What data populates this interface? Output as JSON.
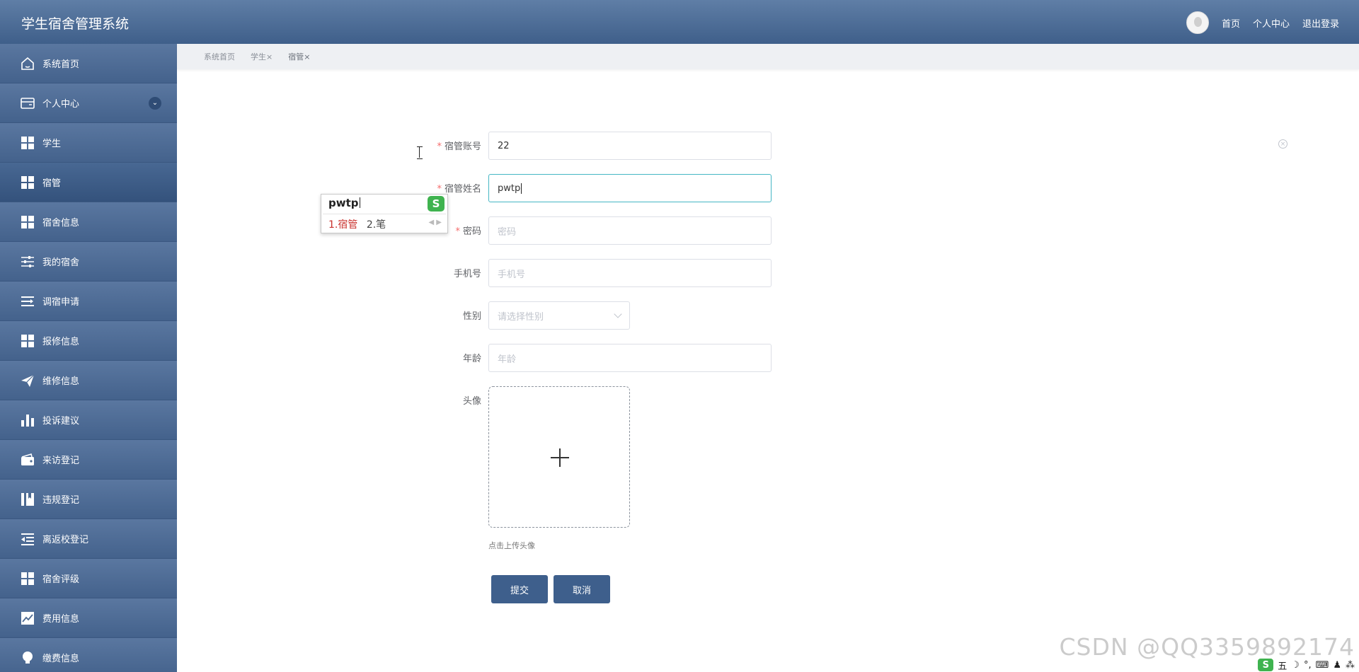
{
  "app": {
    "title": "学生宿舍管理系统"
  },
  "topnav": {
    "home": "首页",
    "profile": "个人中心",
    "logout": "退出登录"
  },
  "sidebar": {
    "items": [
      {
        "label": "系统首页",
        "icon": "home-icon"
      },
      {
        "label": "个人中心",
        "icon": "card-icon"
      },
      {
        "label": "学生",
        "icon": "grid-icon"
      },
      {
        "label": "宿管",
        "icon": "grid-icon"
      },
      {
        "label": "宿舍信息",
        "icon": "grid-icon"
      },
      {
        "label": "我的宿舍",
        "icon": "sliders-icon"
      },
      {
        "label": "调宿申请",
        "icon": "list-arrow-icon"
      },
      {
        "label": "报修信息",
        "icon": "grid-icon"
      },
      {
        "label": "维修信息",
        "icon": "paper-plane-icon"
      },
      {
        "label": "投诉建议",
        "icon": "bar-chart-icon"
      },
      {
        "label": "来访登记",
        "icon": "wallet-icon"
      },
      {
        "label": "违规登记",
        "icon": "book-icon"
      },
      {
        "label": "离返校登记",
        "icon": "indent-icon"
      },
      {
        "label": "宿舍评级",
        "icon": "grid-icon"
      },
      {
        "label": "费用信息",
        "icon": "line-chart-icon"
      },
      {
        "label": "缴费信息",
        "icon": "bulb-icon"
      }
    ]
  },
  "breadcrumb": {
    "items": [
      "系统首页",
      "学生×",
      "宿管×"
    ]
  },
  "form": {
    "account": {
      "label": "宿管账号",
      "value": "22"
    },
    "name": {
      "label": "宿管姓名",
      "value": "pwtp"
    },
    "password": {
      "label": "密码",
      "placeholder": "密码"
    },
    "phone": {
      "label": "手机号",
      "placeholder": "手机号"
    },
    "gender": {
      "label": "性别",
      "placeholder": "请选择性别"
    },
    "age": {
      "label": "年龄",
      "placeholder": "年龄"
    },
    "avatar": {
      "label": "头像",
      "hint": "点击上传头像"
    },
    "submit": "提交",
    "cancel": "取消"
  },
  "ime": {
    "code": "pwtp",
    "logo": "S",
    "candidates": [
      "1.宿管",
      "2.笔"
    ]
  },
  "watermark": "CSDN @QQ3359892174",
  "tray": {
    "logo": "S",
    "items": [
      "五",
      "☽",
      "°,",
      "⌨",
      "♟",
      "⁂"
    ]
  },
  "colors": {
    "header": "#4d6a92",
    "sidebar": "#4d6a92",
    "button": "#3e5f8c",
    "focus_border": "#45b6c4",
    "required": "#f56c6c"
  }
}
